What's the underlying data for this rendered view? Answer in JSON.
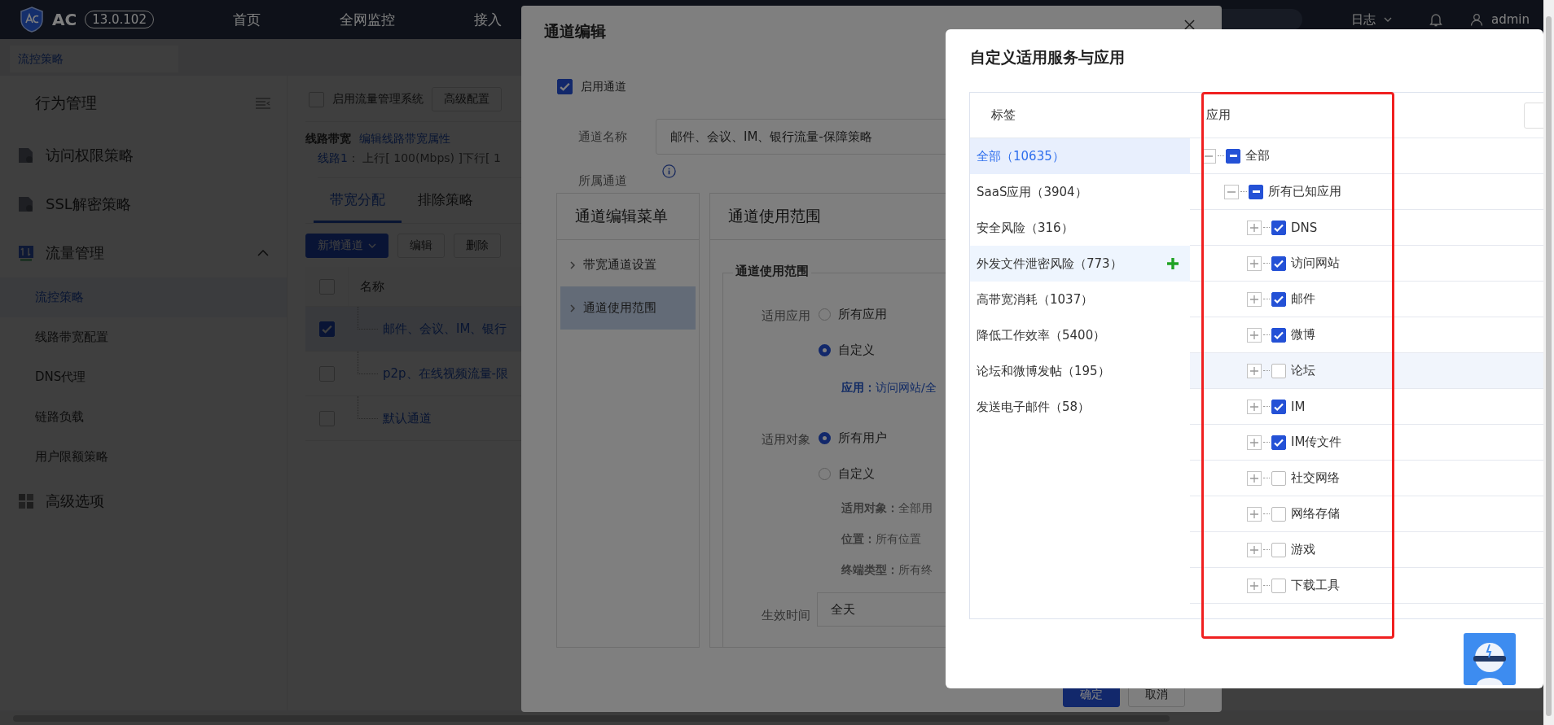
{
  "topbar": {
    "product": "AC",
    "version": "13.0.102",
    "nav": [
      {
        "label": "首页"
      },
      {
        "label": "全网监控"
      },
      {
        "label": "接入"
      }
    ],
    "log_menu": "日志",
    "user": "admin"
  },
  "breadcrumb_tab": "流控策略",
  "sidebar": {
    "title": "行为管理",
    "groups": [
      {
        "label": "访问权限策略"
      },
      {
        "label": "SSL解密策略"
      },
      {
        "label": "流量管理",
        "expanded": true,
        "children": [
          {
            "label": "流控策略",
            "selected": true
          },
          {
            "label": "线路带宽配置",
            "selected": false
          },
          {
            "label": "DNS代理",
            "selected": false
          },
          {
            "label": "链路负载",
            "selected": false
          },
          {
            "label": "用户限额策略",
            "selected": false
          }
        ]
      },
      {
        "label": "高级选项"
      }
    ]
  },
  "traffic": {
    "enable": {
      "label": "启用流量管理系统",
      "checked": false
    },
    "advanced_button": "高级配置",
    "line_title": "线路带宽",
    "line_link": "编辑线路带宽属性",
    "line_name": "线路1",
    "line_detail": "：  上行[ 100(Mbps) ]下行[ 1",
    "tabs": [
      {
        "label": "带宽分配",
        "selected": true
      },
      {
        "label": "排除策略",
        "selected": false
      }
    ],
    "add_button": "新增通道",
    "buttons": [
      "编辑",
      "删除"
    ],
    "table": {
      "columns": [
        "名称"
      ],
      "header_checked": false,
      "rows": [
        {
          "name": "邮件、会议、IM、银行",
          "checked": true
        },
        {
          "name": "p2p、在线视频流量-限",
          "checked": false
        },
        {
          "name": "默认通道",
          "checked": false
        }
      ]
    }
  },
  "channel_dialog": {
    "title": "通道编辑",
    "enable": {
      "label": "启用通道",
      "checked": true
    },
    "name_label": "通道名称",
    "name_value": "邮件、会议、IM、银行流量-保障策略",
    "parent_label": "所属通道",
    "menu_title": "通道编辑菜单",
    "menu_items": [
      {
        "label": "带宽通道设置",
        "selected": false
      },
      {
        "label": "通道使用范围",
        "selected": true
      }
    ],
    "panel_title": "通道使用范围",
    "section_title": "通道使用范围",
    "app_label": "适用应用",
    "app_options": [
      {
        "label": "所有应用",
        "selected": false
      },
      {
        "label": "自定义",
        "selected": true
      }
    ],
    "app_summary": {
      "label": "应用：",
      "value": "访问网站/全"
    },
    "target_label": "适用对象",
    "target_options": [
      {
        "label": "所有用户",
        "selected": true
      },
      {
        "label": "自定义",
        "selected": false
      }
    ],
    "target_details": [
      {
        "label": "适用对象：",
        "value": "全部用"
      },
      {
        "label": "位置：",
        "value": "所有位置"
      },
      {
        "label": "终端类型：",
        "value": "所有终"
      }
    ],
    "time_label": "生效时间",
    "time_value": "全天",
    "buttons": [
      {
        "label": "确定",
        "kind": "primary"
      },
      {
        "label": "取消",
        "kind": "default"
      }
    ]
  },
  "app_dialog": {
    "title": "自定义适用服务与应用",
    "tag_header": "标签",
    "app_header": "应用",
    "tags": [
      {
        "label": "全部（10635）",
        "selected": true,
        "hovered": false
      },
      {
        "label": "SaaS应用（3904）",
        "selected": false,
        "hovered": false
      },
      {
        "label": "安全风险（316）",
        "selected": false,
        "hovered": false
      },
      {
        "label": "外发文件泄密风险（773）",
        "selected": false,
        "hovered": true
      },
      {
        "label": "高带宽消耗（1037）",
        "selected": false,
        "hovered": false
      },
      {
        "label": "降低工作效率（5400）",
        "selected": false,
        "hovered": false
      },
      {
        "label": "论坛和微博发帖（195）",
        "selected": false,
        "hovered": false
      },
      {
        "label": "发送电子邮件（58）",
        "selected": false,
        "hovered": false
      }
    ],
    "tree": [
      {
        "label": "全部",
        "expanded": true,
        "indeterminate": true,
        "hovered": false,
        "children": [
          {
            "label": "所有已知应用",
            "expanded": true,
            "indeterminate": true,
            "hovered": false,
            "children": [
              {
                "label": "DNS",
                "expanded": false,
                "checked": true,
                "hovered": false
              },
              {
                "label": "访问网站",
                "expanded": false,
                "checked": true,
                "hovered": false
              },
              {
                "label": "邮件",
                "expanded": false,
                "checked": true,
                "hovered": false
              },
              {
                "label": "微博",
                "expanded": false,
                "checked": true,
                "hovered": false
              },
              {
                "label": "论坛",
                "expanded": false,
                "checked": false,
                "hovered": true
              },
              {
                "label": "IM",
                "expanded": false,
                "checked": true,
                "hovered": false
              },
              {
                "label": "IM传文件",
                "expanded": false,
                "checked": true,
                "hovered": false
              },
              {
                "label": "社交网络",
                "expanded": false,
                "checked": false,
                "hovered": false
              },
              {
                "label": "网络存储",
                "expanded": false,
                "checked": false,
                "hovered": false
              },
              {
                "label": "游戏",
                "expanded": false,
                "checked": false,
                "hovered": false
              },
              {
                "label": "下载工具",
                "expanded": false,
                "checked": false,
                "hovered": false
              }
            ]
          }
        ]
      }
    ]
  }
}
